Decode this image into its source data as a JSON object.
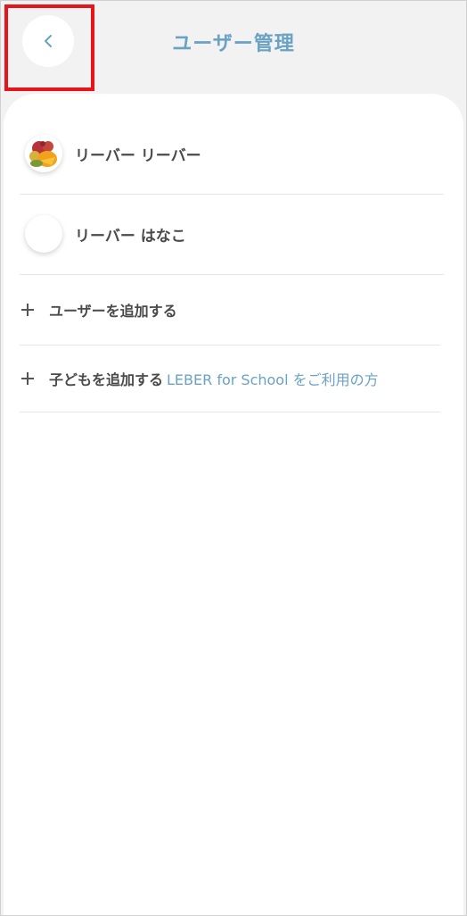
{
  "header": {
    "title": "ユーザー管理",
    "back_icon": "chevron-left-icon"
  },
  "users": [
    {
      "name": "リーバー リーバー",
      "avatar": "fruit-photo"
    },
    {
      "name": "リーバー はなこ",
      "avatar": "blank"
    }
  ],
  "actions": {
    "add_user_label": "ユーザーを追加する",
    "add_child_label": "子どもを追加する",
    "school_link": "LEBER for School をご利用の方"
  },
  "colors": {
    "accent": "#6aa2c4",
    "text": "#4a4a4a",
    "highlight": "#e8141c",
    "background": "#f2f2f2"
  }
}
